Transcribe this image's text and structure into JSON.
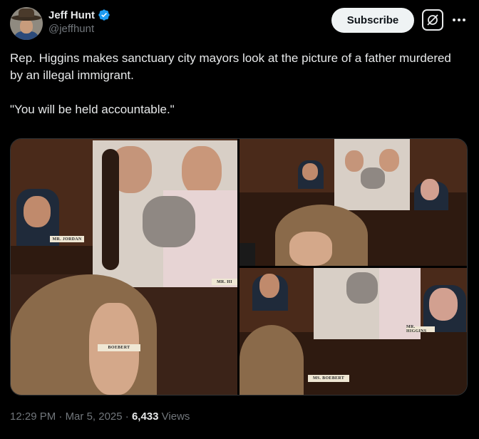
{
  "author": {
    "name": "Jeff Hunt",
    "handle": "@jeffhunt",
    "verified_icon": "verified-badge-icon",
    "avatar_icon": "avatar-cowboy-hat"
  },
  "actions": {
    "subscribe_label": "Subscribe",
    "grok_icon": "grok-icon",
    "more_icon": "more-icon"
  },
  "tweet": {
    "text": "Rep. Higgins makes sanctuary city mayors look at the picture of a father murdered by an illegal immigrant.\n\n\"You will be held accountable.\""
  },
  "media": {
    "photo1": {
      "placards": [
        "MR. JORDAN",
        "MR. HI",
        "BOEBERT"
      ]
    },
    "photo2": {
      "placards": []
    },
    "photo3": {
      "placards": [
        "MR. HIGGINS",
        "MS. BOEBERT"
      ]
    }
  },
  "meta": {
    "time": "12:29 PM",
    "sep1": "·",
    "date": "Mar 5, 2025",
    "sep2": "·",
    "views_count": "6,433",
    "views_label": "Views"
  },
  "colors": {
    "background": "#000000",
    "text": "#e7e9ea",
    "secondary_text": "#71767b",
    "verified_blue": "#1d9bf0",
    "subscribe_bg": "#eff3f4"
  }
}
